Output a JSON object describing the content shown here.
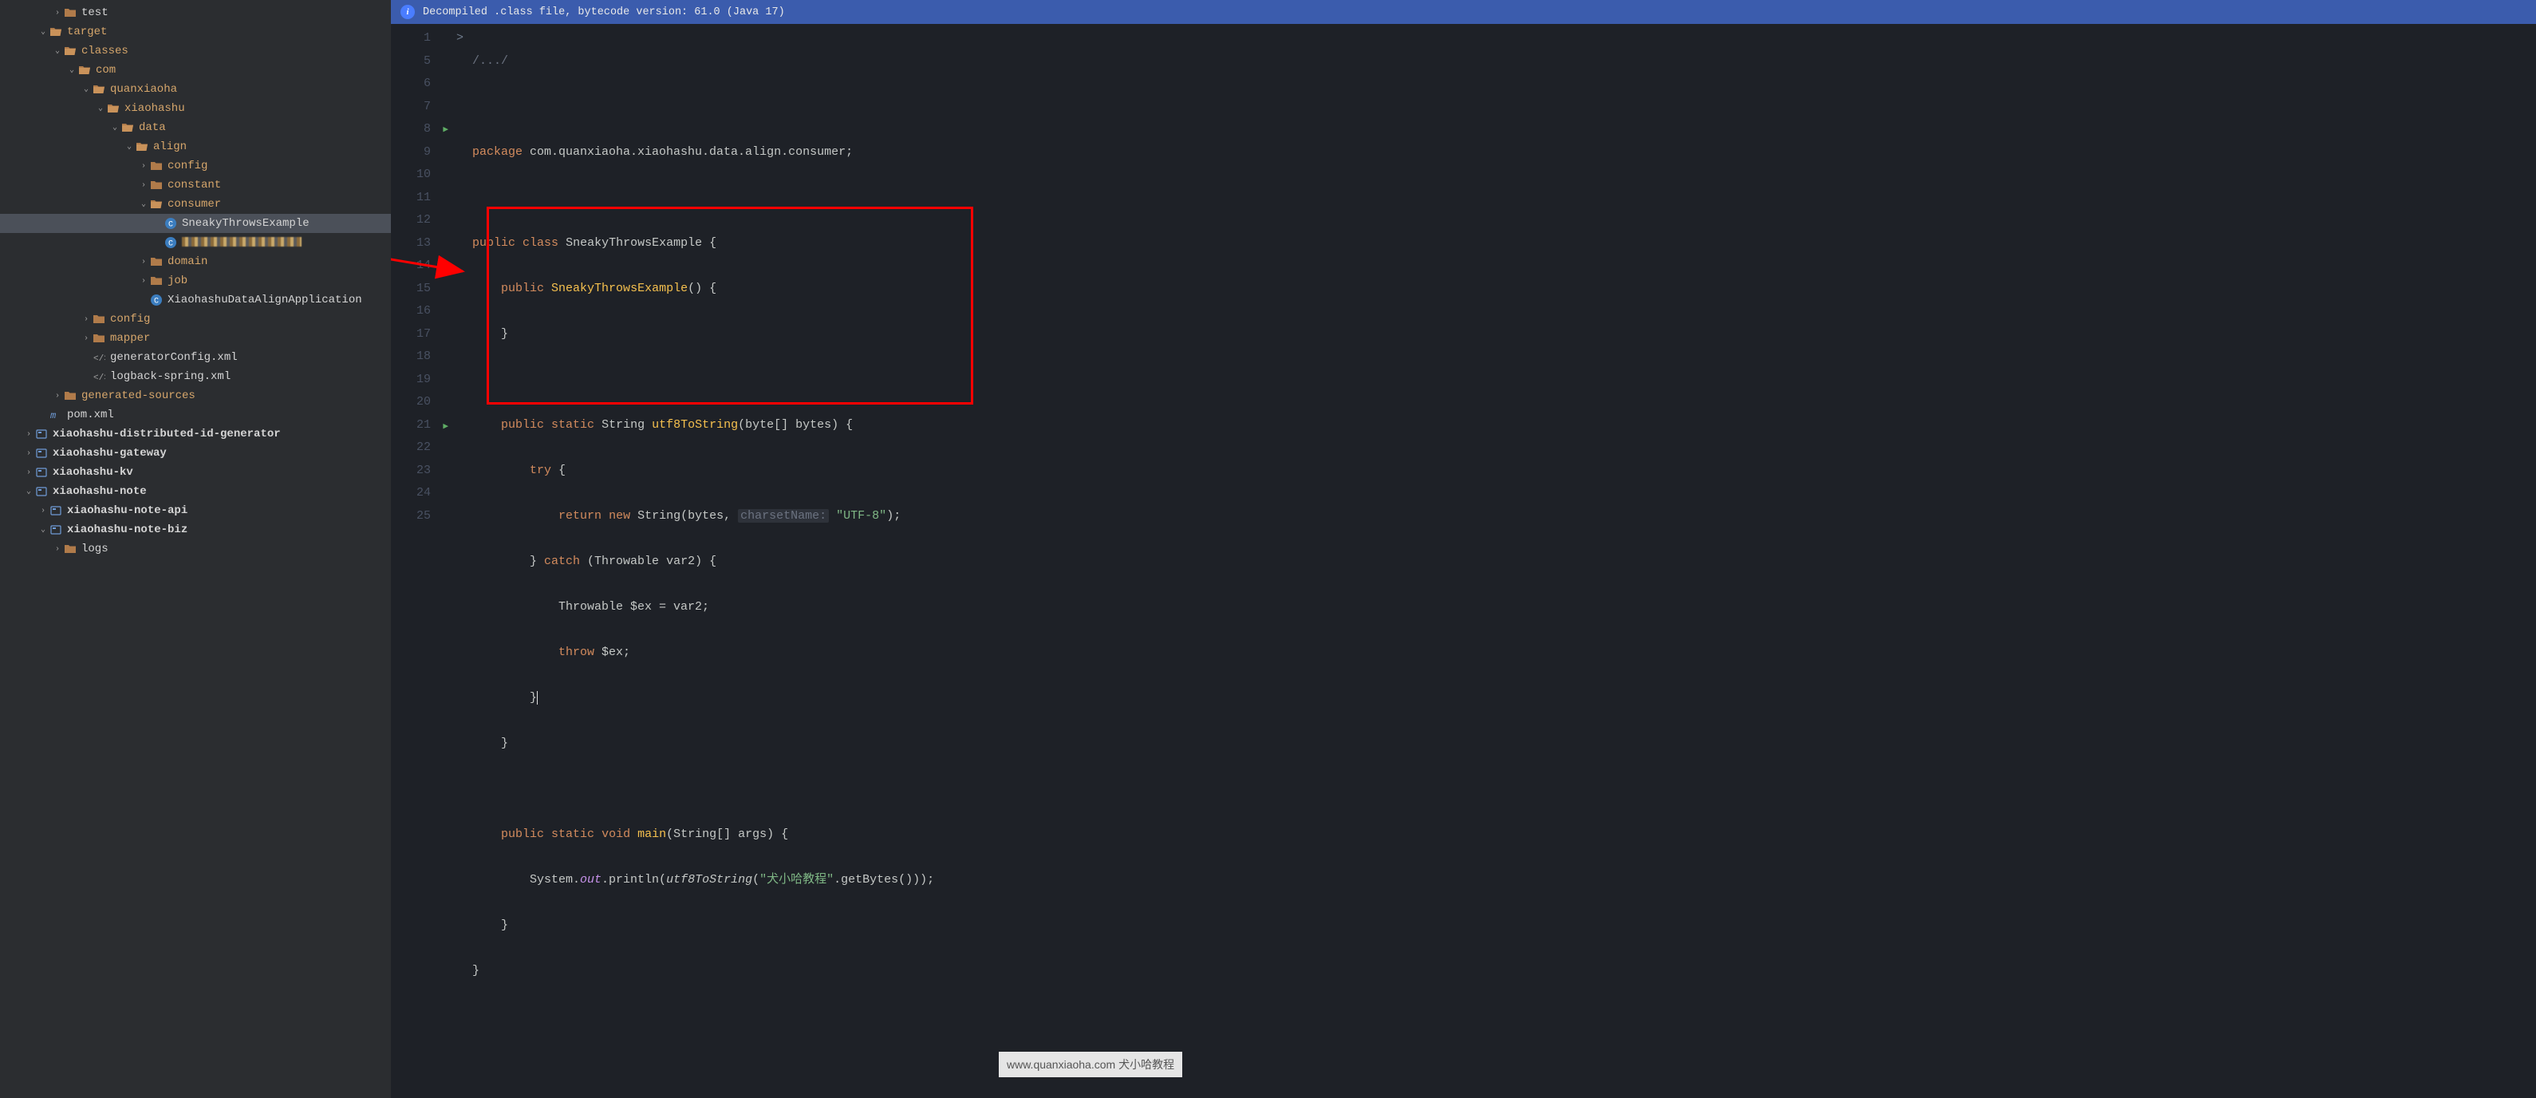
{
  "banner": {
    "text": "Decompiled .class file, bytecode version: 61.0 (Java 17)"
  },
  "tree": [
    {
      "indent": 3,
      "chev": ">",
      "icon": "folder",
      "label": "test"
    },
    {
      "indent": 2,
      "chev": "v",
      "icon": "folder-open",
      "label": "target",
      "hl": true
    },
    {
      "indent": 3,
      "chev": "v",
      "icon": "folder-open",
      "label": "classes",
      "hl": true
    },
    {
      "indent": 4,
      "chev": "v",
      "icon": "folder-open",
      "label": "com",
      "hl": true
    },
    {
      "indent": 5,
      "chev": "v",
      "icon": "folder-open",
      "label": "quanxiaoha",
      "hl": true
    },
    {
      "indent": 6,
      "chev": "v",
      "icon": "folder-open",
      "label": "xiaohashu",
      "hl": true
    },
    {
      "indent": 7,
      "chev": "v",
      "icon": "folder-open",
      "label": "data",
      "hl": true
    },
    {
      "indent": 8,
      "chev": "v",
      "icon": "folder-open",
      "label": "align",
      "hl": true
    },
    {
      "indent": 9,
      "chev": ">",
      "icon": "folder",
      "label": "config",
      "hl": true
    },
    {
      "indent": 9,
      "chev": ">",
      "icon": "folder",
      "label": "constant",
      "hl": true
    },
    {
      "indent": 9,
      "chev": "v",
      "icon": "folder-open",
      "label": "consumer",
      "hl": true
    },
    {
      "indent": 10,
      "chev": "",
      "icon": "class",
      "label": "SneakyThrowsExample",
      "selected": true
    },
    {
      "indent": 10,
      "chev": "",
      "icon": "class",
      "label": "",
      "blur": true
    },
    {
      "indent": 9,
      "chev": ">",
      "icon": "folder",
      "label": "domain",
      "hl": true
    },
    {
      "indent": 9,
      "chev": ">",
      "icon": "folder",
      "label": "job",
      "hl": true
    },
    {
      "indent": 9,
      "chev": "",
      "icon": "class",
      "label": "XiaohashuDataAlignApplication"
    },
    {
      "indent": 5,
      "chev": ">",
      "icon": "folder",
      "label": "config",
      "hl": true
    },
    {
      "indent": 5,
      "chev": ">",
      "icon": "folder",
      "label": "mapper",
      "hl": true
    },
    {
      "indent": 5,
      "chev": "",
      "icon": "xml",
      "label": "generatorConfig.xml"
    },
    {
      "indent": 5,
      "chev": "",
      "icon": "xml",
      "label": "logback-spring.xml"
    },
    {
      "indent": 3,
      "chev": ">",
      "icon": "folder",
      "label": "generated-sources",
      "hl": true
    },
    {
      "indent": 2,
      "chev": "",
      "icon": "maven",
      "label": "pom.xml"
    },
    {
      "indent": 1,
      "chev": ">",
      "icon": "module",
      "label": "xiaohashu-distributed-id-generator",
      "bold": true
    },
    {
      "indent": 1,
      "chev": ">",
      "icon": "module",
      "label": "xiaohashu-gateway",
      "bold": true
    },
    {
      "indent": 1,
      "chev": ">",
      "icon": "module",
      "label": "xiaohashu-kv",
      "bold": true
    },
    {
      "indent": 1,
      "chev": "v",
      "icon": "module",
      "label": "xiaohashu-note",
      "bold": true
    },
    {
      "indent": 2,
      "chev": ">",
      "icon": "module",
      "label": "xiaohashu-note-api",
      "bold": true
    },
    {
      "indent": 2,
      "chev": "v",
      "icon": "module",
      "label": "xiaohashu-note-biz",
      "bold": true
    },
    {
      "indent": 3,
      "chev": ">",
      "icon": "folder",
      "label": "logs"
    }
  ],
  "lines": [
    1,
    5,
    6,
    7,
    8,
    9,
    10,
    11,
    12,
    13,
    14,
    15,
    16,
    17,
    18,
    19,
    20,
    21,
    22,
    23,
    24,
    25
  ],
  "run_gutter": {
    "8": true,
    "21": true
  },
  "fold_gutter": {
    "1": ">"
  },
  "code": {
    "l1_a": "/.../",
    "l6": "package com.quanxiaoha.xiaohashu.data.align.consumer;",
    "l8_kw1": "public",
    "l8_kw2": "class",
    "l8_name": "SneakyThrowsExample",
    "l8_brace": " {",
    "l9_kw": "public",
    "l9_ctor": "SneakyThrowsExample",
    "l9_rest": "() {",
    "l10": "    }",
    "l12_kw1": "public",
    "l12_kw2": "static",
    "l12_ret": "String",
    "l12_fn": "utf8ToString",
    "l12_args": "(byte[] bytes) {",
    "l13_kw": "try",
    "l13_rest": " {",
    "l14_kw1": "return",
    "l14_kw2": "new",
    "l14_cls": "String",
    "l14_a": "(bytes, ",
    "l14_hint": "charsetName:",
    "l14_str": "\"UTF-8\"",
    "l14_end": ");",
    "l15_a": "} ",
    "l15_kw": "catch",
    "l15_rest": " (Throwable var2) {",
    "l16": "            Throwable $ex = var2;",
    "l17_kw": "throw",
    "l17_rest": " $ex;",
    "l18": "        }",
    "l19": "    }",
    "l21_kw1": "public",
    "l21_kw2": "static",
    "l21_kw3": "void",
    "l21_fn": "main",
    "l21_args": "(String[] args) {",
    "l22_a": "System.",
    "l22_f": "out",
    "l22_b": ".println(",
    "l22_c": "utf8ToString",
    "l22_d": "(",
    "l22_str": "\"犬小哈教程\"",
    "l22_e": ".getBytes()));",
    "l23": "    }",
    "l24": "}"
  },
  "watermark": "www.quanxiaoha.com 犬小哈教程"
}
